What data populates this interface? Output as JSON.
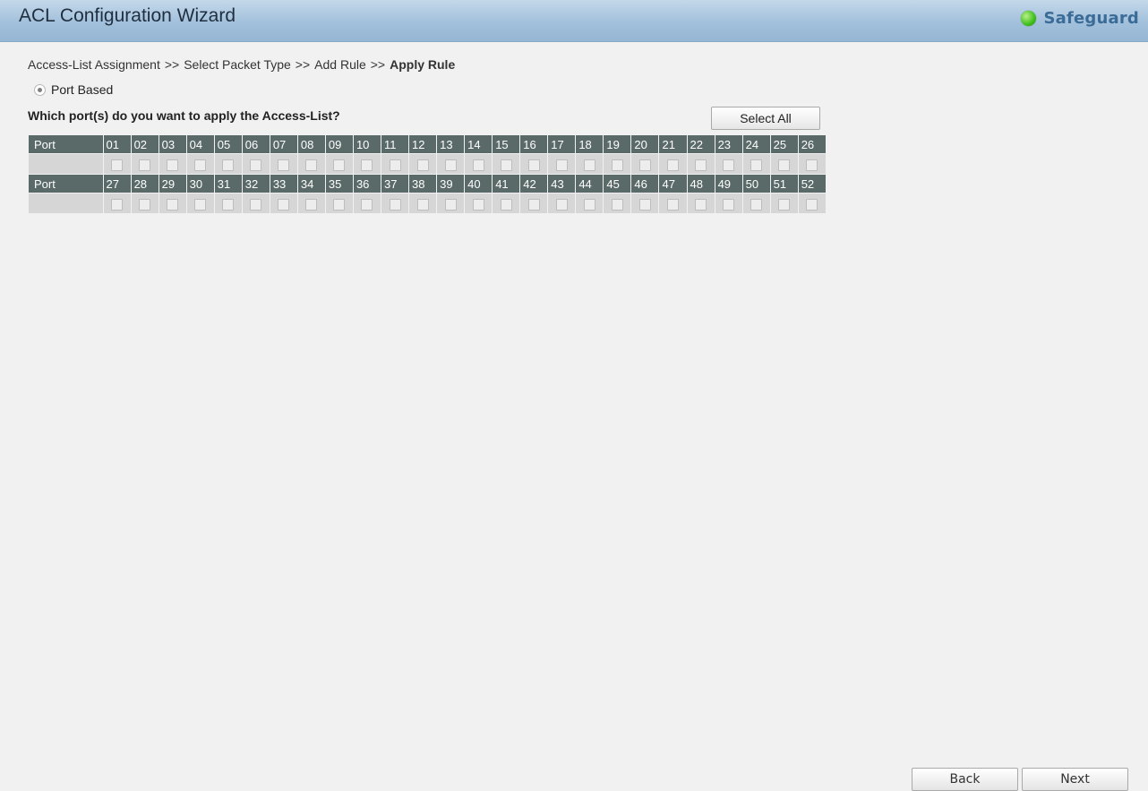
{
  "window": {
    "title": "ACL Configuration Wizard",
    "status_label": "Safeguard",
    "status_color": "#3fbf1c"
  },
  "breadcrumb": {
    "steps": [
      "Access-List Assignment",
      "Select Packet Type",
      "Add Rule"
    ],
    "separator": ">>",
    "current": "Apply Rule"
  },
  "mode": {
    "label": "Port Based",
    "selected": true
  },
  "question": "Which port(s) do you want to apply the Access-List?",
  "select_all_label": "Select All",
  "port_table": {
    "row_label": "Port",
    "rows": [
      [
        "01",
        "02",
        "03",
        "04",
        "05",
        "06",
        "07",
        "08",
        "09",
        "10",
        "11",
        "12",
        "13",
        "14",
        "15",
        "16",
        "17",
        "18",
        "19",
        "20",
        "21",
        "22",
        "23",
        "24",
        "25",
        "26"
      ],
      [
        "27",
        "28",
        "29",
        "30",
        "31",
        "32",
        "33",
        "34",
        "35",
        "36",
        "37",
        "38",
        "39",
        "40",
        "41",
        "42",
        "43",
        "44",
        "45",
        "46",
        "47",
        "48",
        "49",
        "50",
        "51",
        "52"
      ]
    ],
    "checked": []
  },
  "buttons": {
    "back": "Back",
    "next": "Next"
  },
  "colors": {
    "title_bar": "#a2c0db",
    "table_header": "#5a6a69",
    "table_checkbox_row": "#d6d6d6"
  }
}
